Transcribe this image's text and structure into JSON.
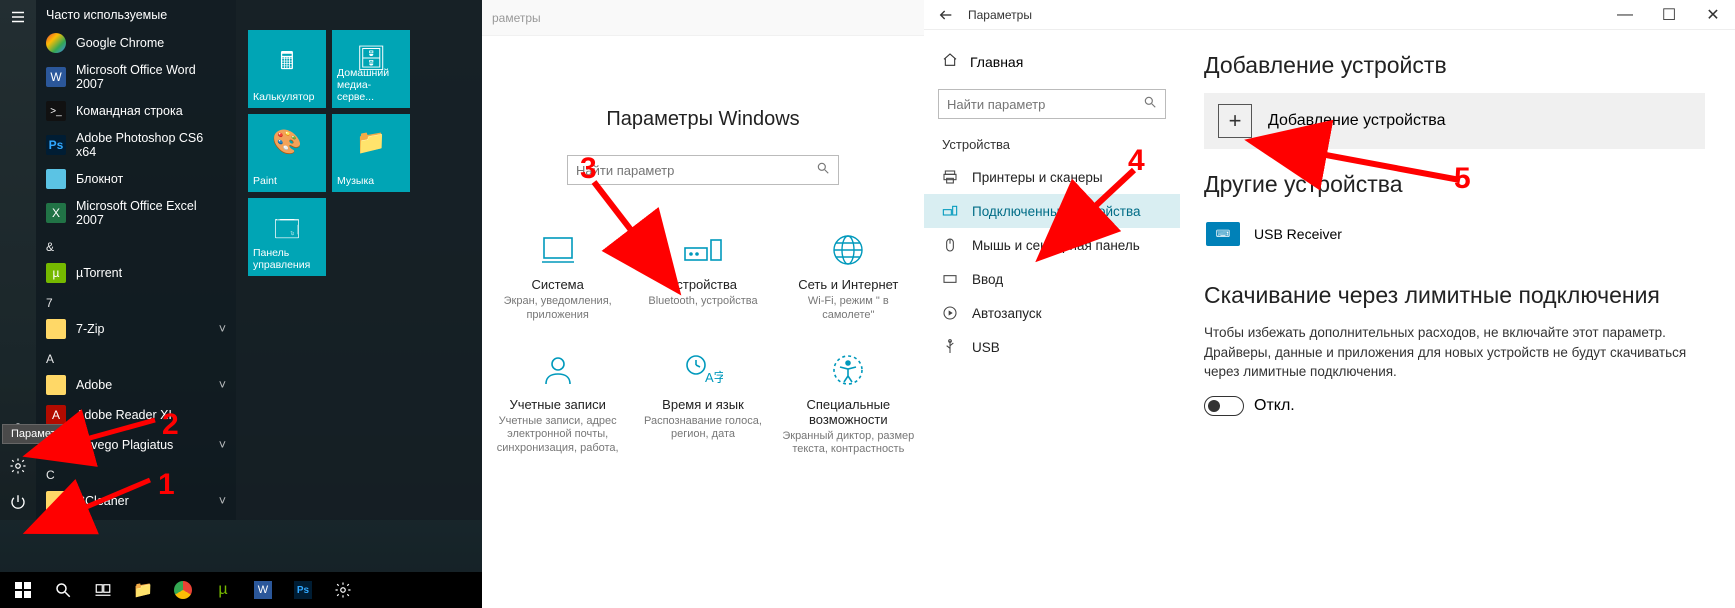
{
  "annotations": {
    "n1": "1",
    "n2": "2",
    "n3": "3",
    "n4": "4",
    "n5": "5"
  },
  "start": {
    "tooltip": "Параметры",
    "frequent_header": "Часто используемые",
    "frequent": [
      {
        "label": "Google Chrome"
      },
      {
        "label": "Microsoft Office Word 2007"
      },
      {
        "label": "Командная строка"
      },
      {
        "label": "Adobe Photoshop CS6 x64"
      },
      {
        "label": "Блокнот"
      },
      {
        "label": "Microsoft Office Excel 2007"
      }
    ],
    "groups": [
      {
        "letter": "&",
        "items": [
          {
            "label": "µTorrent"
          }
        ]
      },
      {
        "letter": "7",
        "items": [
          {
            "label": "7-Zip",
            "expandable": true
          }
        ]
      },
      {
        "letter": "A",
        "items": [
          {
            "label": "Adobe",
            "expandable": true
          },
          {
            "label": "Adobe Reader XI"
          },
          {
            "label": "Advego Plagiatus",
            "expandable": true
          }
        ]
      },
      {
        "letter": "C",
        "items": [
          {
            "label": "CCleaner",
            "expandable": true
          }
        ]
      }
    ],
    "tiles": [
      {
        "label": "Калькулятор",
        "icon": "calc"
      },
      {
        "label": "Домашний медиа-серве...",
        "icon": "media"
      },
      {
        "label": "Paint",
        "icon": "paint"
      },
      {
        "label": "Музыка",
        "icon": "folder"
      },
      {
        "label": "Панель управления",
        "icon": "panel"
      }
    ]
  },
  "settings_home": {
    "breadcrumb": "раметры",
    "title": "Параметры Windows",
    "search_placeholder": "Найти параметр",
    "categories": [
      {
        "name": "Система",
        "desc": "Экран, уведомления, приложения"
      },
      {
        "name": "Устройства",
        "desc": "Bluetooth, устройства"
      },
      {
        "name": "Сеть и Интернет",
        "desc": "Wi-Fi, режим \" в самолете\""
      },
      {
        "name": "Учетные записи",
        "desc": "Учетные записи, адрес электронной почты, синхронизация, работа,"
      },
      {
        "name": "Время и язык",
        "desc": "Распознавание голоса, регион, дата"
      },
      {
        "name": "Специальные возможности",
        "desc": "Экранный диктор, размер текста, контрастность"
      }
    ]
  },
  "devices": {
    "window_title": "Параметры",
    "home_label": "Главная",
    "search_placeholder": "Найти параметр",
    "section_header": "Устройства",
    "side_items": [
      {
        "label": "Принтеры и сканеры"
      },
      {
        "label": "Подключенные устройства",
        "active": true
      },
      {
        "label": "Мышь и сенсорная панель"
      },
      {
        "label": "Ввод"
      },
      {
        "label": "Автозапуск"
      },
      {
        "label": "USB"
      }
    ],
    "h_add": "Добавление устройств",
    "add_button": "Добавление устройства",
    "h_other": "Другие устройства",
    "device1": "USB Receiver",
    "h_metered": "Скачивание через лимитные подключения",
    "metered_text": "Чтобы избежать дополнительных расходов, не включайте этот параметр. Драйверы, данные и приложения для новых устройств не будут скачиваться через лимитные подключения.",
    "toggle_off": "Откл."
  }
}
